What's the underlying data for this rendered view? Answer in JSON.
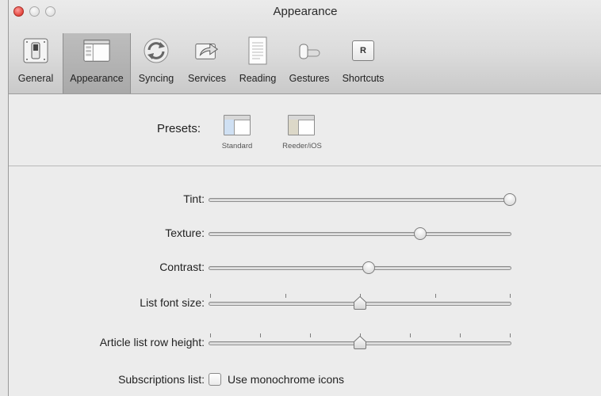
{
  "window": {
    "title": "Appearance"
  },
  "toolbar": {
    "tabs": [
      {
        "label": "General",
        "icon": "toggle-switch-icon"
      },
      {
        "label": "Appearance",
        "icon": "window-layout-icon",
        "selected": true
      },
      {
        "label": "Syncing",
        "icon": "sync-arrows-icon"
      },
      {
        "label": "Services",
        "icon": "share-arrow-icon"
      },
      {
        "label": "Reading",
        "icon": "document-icon"
      },
      {
        "label": "Gestures",
        "icon": "slider-switch-icon"
      },
      {
        "label": "Shortcuts",
        "icon": "key-r-icon",
        "key_letter": "R"
      }
    ]
  },
  "presets": {
    "label": "Presets:",
    "items": [
      {
        "caption": "Standard",
        "sidebar_color": "#cfe0f3"
      },
      {
        "caption": "Reeder/iOS",
        "sidebar_color": "#dcd8c8"
      }
    ]
  },
  "sliders": [
    {
      "label": "Tint:",
      "value": 1.0
    },
    {
      "label": "Texture:",
      "value": 0.7
    },
    {
      "label": "Contrast:",
      "value": 0.53
    },
    {
      "label": "List font size:",
      "value": 0.5,
      "ticks": 5
    },
    {
      "label": "Article list row height:",
      "value": 0.5,
      "ticks": 7
    }
  ],
  "subscriptions": {
    "label": "Subscriptions list:",
    "checkbox_label": "Use monochrome icons",
    "checked": false
  }
}
